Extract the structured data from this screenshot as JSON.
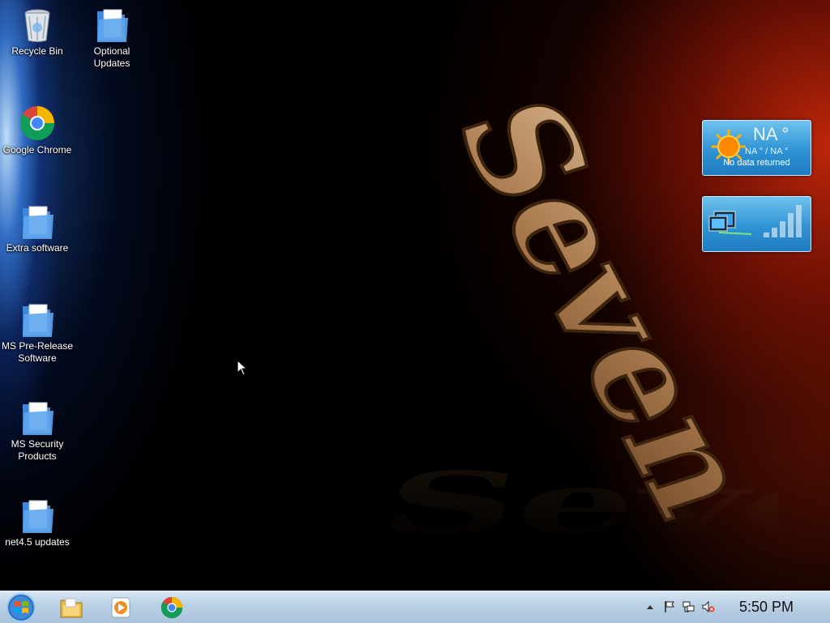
{
  "desktop_icons": [
    {
      "label": "Recycle Bin",
      "icon": "recycle-bin-icon"
    },
    {
      "label_line1": "Optional",
      "label_line2": "Updates",
      "icon": "folder-icon"
    },
    {
      "label": "Google Chrome",
      "icon": "chrome-icon"
    },
    {
      "label": "Extra software",
      "icon": "folder-icon"
    },
    {
      "label_line1": "MS Pre-Release",
      "label_line2": "Software",
      "icon": "folder-icon"
    },
    {
      "label_line1": "MS Security",
      "label_line2": "Products",
      "icon": "folder-icon"
    },
    {
      "label": "net4.5 updates",
      "icon": "folder-icon"
    }
  ],
  "wallpaper": {
    "text": "Seven"
  },
  "gadgets": {
    "weather": {
      "temp": "NA °",
      "hilo": "NA ° / NA °",
      "status": "No data returned"
    },
    "network_meter": {
      "icon": "network-meter-icon"
    }
  },
  "taskbar": {
    "start_icon": "windows-start-icon",
    "pinned": [
      "file-explorer-icon",
      "media-player-icon",
      "chrome-icon"
    ],
    "tray": [
      "show-hidden-icons-arrow",
      "action-center-flag-icon",
      "network-icon",
      "volume-muted-icon"
    ],
    "clock": "5:50 PM"
  },
  "colors": {
    "taskbar": "#b9d0e4",
    "gadget_blue": "#2f93d4",
    "wallpaper_red": "#c0280a",
    "wallpaper_blue": "#3c82e6"
  }
}
